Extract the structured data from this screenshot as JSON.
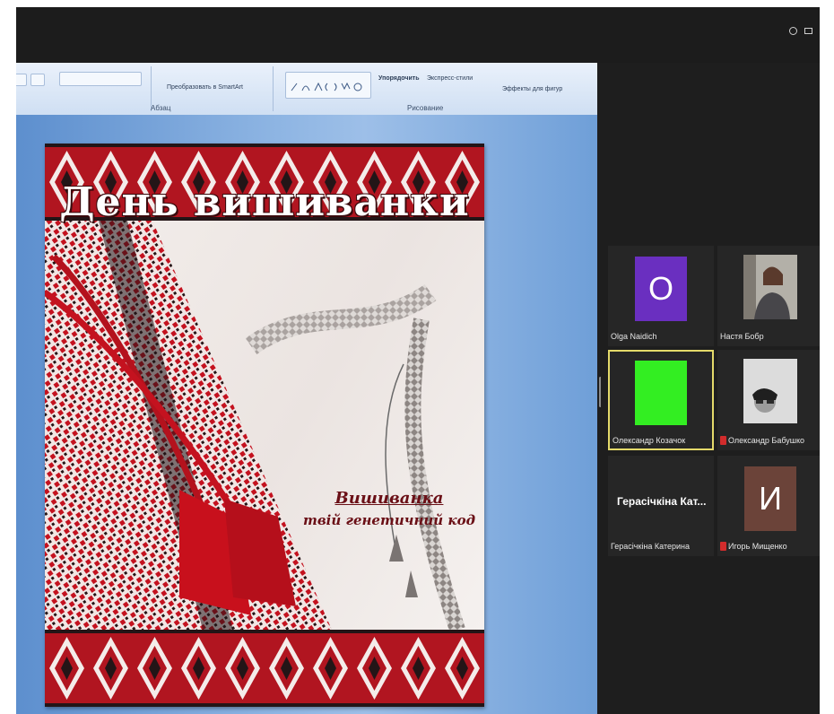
{
  "colors": {
    "accent_embroidery": "#b11520",
    "dark_red": "#6a0f16",
    "avatar_purple": "#6a2fc0",
    "avatar_green": "#33ee22",
    "avatar_brown": "#6b4339",
    "active_border": "#e4da6a"
  },
  "ribbon": {
    "group_paragraph": "Абзац",
    "group_drawing": "Рисование",
    "convert_smartart": "Преобразовать в SmartArt",
    "arrange": "Упорядочить",
    "quick_styles": "Экспресс-стили",
    "shape_effects": "Эффекты для фигур"
  },
  "slide": {
    "title": "День вишиванки",
    "caption_line1": "Вишиванка",
    "caption_line2": "твій генетичний код"
  },
  "participants": [
    {
      "avatar": "O",
      "name": "Olga Naidich"
    },
    {
      "name": "Настя Бобр"
    },
    {
      "name": "Олександр Козачок"
    },
    {
      "name": "Олександр Бабушко"
    },
    {
      "tile_title": "Герасічкіна Кат...",
      "name": "Герасічкіна Катерина"
    },
    {
      "avatar": "И",
      "name": "Игорь Мищенко"
    }
  ]
}
